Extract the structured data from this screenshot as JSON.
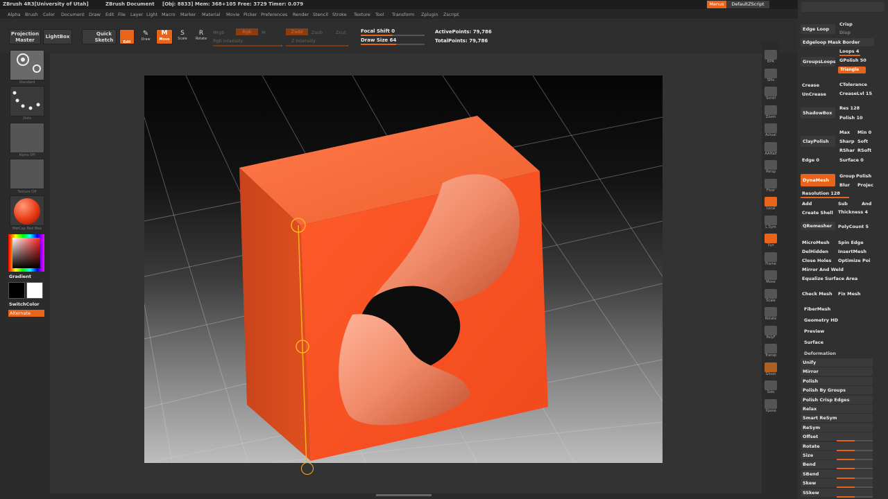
{
  "titlebar": {
    "app": "ZBrush 4R3[University of Utah]",
    "document": "ZBrush Document",
    "stats": "[Obj: 8833] Mem: 368+105 Free: 3729 Timer: 0.079",
    "menus_btn": "Menus",
    "script": "DefaultZScript"
  },
  "menubar": [
    "Alpha",
    "Brush",
    "Color",
    "Document",
    "Draw",
    "Edit",
    "File",
    "Layer",
    "Light",
    "Macro",
    "Marker",
    "Material",
    "Movie",
    "Picker",
    "Preferences",
    "Render",
    "Stencil",
    "Stroke",
    "Texture",
    "Tool",
    "Transform",
    "Zplugin",
    "Zscript"
  ],
  "toolbar": {
    "projection_master": "Projection Master",
    "lightbox": "LightBox",
    "quick_sketch": "Quick Sketch",
    "edit": "Edit",
    "draw": "Draw",
    "move": "Move",
    "scale": "Scale",
    "rotate": "Rotate",
    "mrgb": "Mrgb",
    "rgb": "Rgb",
    "m": "M",
    "zadd": "Zadd",
    "zsub": "Zsub",
    "zcut": "Zcut",
    "rgb_intensity": "Rgb Intensity",
    "z_intensity": "Z Intensity",
    "focal_shift_label": "Focal Shift 0",
    "draw_size_label": "Draw Size 64",
    "active_points": "ActivePoints: 79,786",
    "total_points": "TotalPoints: 79,786",
    "focal_shift": 0.5,
    "draw_size": 0.55
  },
  "leftshelf": {
    "brush_label": "Standard",
    "stroke_label": "Dots",
    "alpha_label": "Alpha Off",
    "texture_label": "Texture Off",
    "material_label": "MatCap Red Wax",
    "gradient": "Gradient",
    "switch_color": "SwitchColor",
    "alternate": "Alternate"
  },
  "rshelf": [
    "BPR",
    "SPix",
    "Scroll",
    "Zoom",
    "Actual",
    "AAHalf",
    "Persp",
    "Floor",
    "Local",
    "L.Sym",
    "Xyz",
    "Frame",
    "Move",
    "Scale",
    "Rotate",
    "PolyF",
    "Transp",
    "Ghost",
    "Solo",
    "Xpose"
  ],
  "rpanel": {
    "edge_loop": "Edge Loop",
    "crisp": "Crisp",
    "disp": "Disp",
    "edgeloop_mask_border": "Edgeloop Mask Border",
    "loops": "Loops 4",
    "groups_loops": "GroupsLoops",
    "gpolish": "GPolish 50",
    "triangle": "Triangle",
    "crease": "Crease",
    "uncrease": "UnCrease",
    "ctolerance": "CTolerance",
    "creaselvl": "CreaseLvl 15",
    "shadowbox": "ShadowBox",
    "res": "Res 128",
    "polish": "Polish 10",
    "claypolish": "ClayPolish",
    "max": "Max",
    "min": "Min 0",
    "sharp": "Sharp",
    "soft": "Soft",
    "rshar": "RShar",
    "rsoft": "RSoft",
    "edge": "Edge 0",
    "surface": "Surface 0",
    "dynamesh": "DynaMesh",
    "group": "Group",
    "polish2": "Polish",
    "blur": "Blur",
    "project": "Projec",
    "resolution": "Resolution 128",
    "add": "Add",
    "sub": "Sub",
    "and": "And",
    "create_shell": "Create Shell",
    "thickness": "Thickness 4",
    "qremesher": "QRemesher",
    "polycount": "PolyCount 5",
    "micromesh": "MicroMesh",
    "spin_edge": "Spin Edge",
    "delhidden": "DelHidden",
    "insertmesh": "InsertMesh",
    "close_holes": "Close Holes",
    "optimize": "Optimize Poi",
    "mirror_weld": "Mirror And Weld",
    "equalize": "Equalize Surface Area",
    "check_mesh": "Check Mesh",
    "fix_mesh": "Fix Mesh",
    "fibermesh": "FiberMesh",
    "geometry_hd": "Geometry HD",
    "preview": "Preview",
    "surface_menu": "Surface",
    "deformation": "Deformation",
    "def_items": [
      "Unify",
      "Mirror",
      "Polish",
      "Polish By Groups",
      "Polish Crisp Edges",
      "Relax",
      "Smart ReSym",
      "ReSym",
      "Offset",
      "Rotate",
      "Size",
      "Bend",
      "SBend",
      "Skew",
      "SSkew"
    ]
  },
  "colors": {
    "accent": "#e8641a",
    "mesh": "#ef5a2c"
  }
}
